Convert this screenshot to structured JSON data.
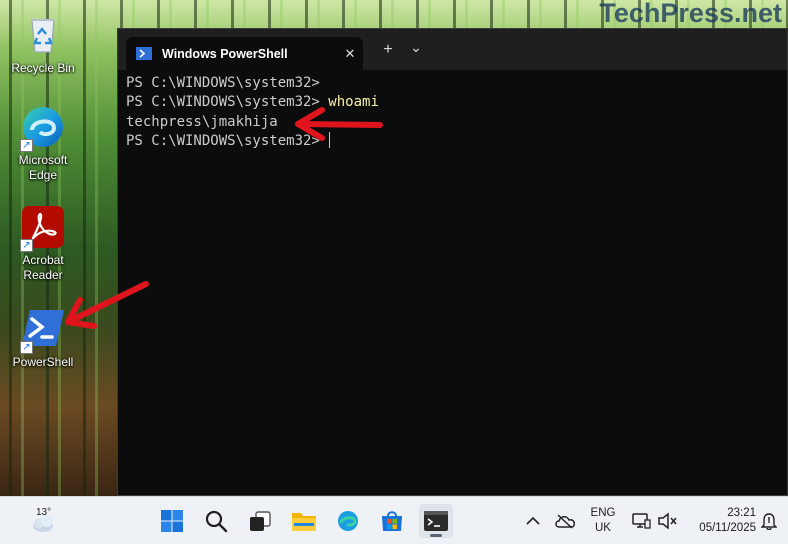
{
  "watermark": "TechPress.net",
  "desktop_icons": [
    {
      "name": "recycle-bin",
      "label": "Recycle Bin"
    },
    {
      "name": "microsoft-edge",
      "label": "Microsoft Edge"
    },
    {
      "name": "acrobat-reader",
      "label": "Acrobat Reader"
    },
    {
      "name": "powershell",
      "label": "PowerShell"
    }
  ],
  "window": {
    "tab_title": "Windows PowerShell",
    "close_glyph": "✕",
    "new_tab_glyph": "+",
    "dropdown_glyph": "⌄",
    "window_controls": {
      "minimize": "—",
      "maximize": "☐",
      "close": "✕"
    }
  },
  "console": {
    "lines": [
      {
        "prompt": "PS C:\\WINDOWS\\system32>",
        "command": ""
      },
      {
        "prompt": "PS C:\\WINDOWS\\system32>",
        "command": " whoami"
      },
      {
        "output": "techpress\\jmakhija"
      },
      {
        "prompt": "PS C:\\WINDOWS\\system32>",
        "command": " "
      }
    ]
  },
  "taskbar": {
    "weather_temp": "13°",
    "language_line1": "ENG",
    "language_line2": "UK",
    "time": "23:21",
    "date": "05/11/2025",
    "icons": [
      "windows-start-icon",
      "search-icon",
      "task-view-icon",
      "file-explorer-icon",
      "edge-icon",
      "microsoft-store-icon",
      "terminal-icon"
    ]
  },
  "colors": {
    "annotation_arrow": "#e0141c",
    "console_bg": "#0c0c0c",
    "console_text": "#cccccc",
    "command_text": "#f9f1a5",
    "powershell_blue": "#2f6fd6"
  }
}
